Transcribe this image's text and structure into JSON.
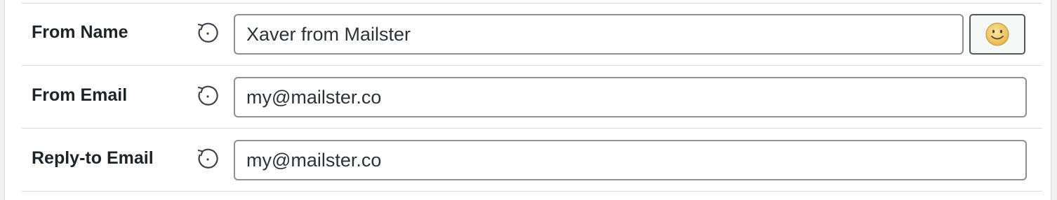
{
  "fields": [
    {
      "label": "From Name",
      "value": "Xaver from Mailster"
    },
    {
      "label": "From Email",
      "value": "my@mailster.co"
    },
    {
      "label": "Reply-to Email",
      "value": "my@mailster.co"
    }
  ],
  "icons": {
    "reset": "reset-icon",
    "emoji": "smiley-icon"
  },
  "colors": {
    "emoji_face": "#f5d36b",
    "border": "#8c8f94"
  }
}
